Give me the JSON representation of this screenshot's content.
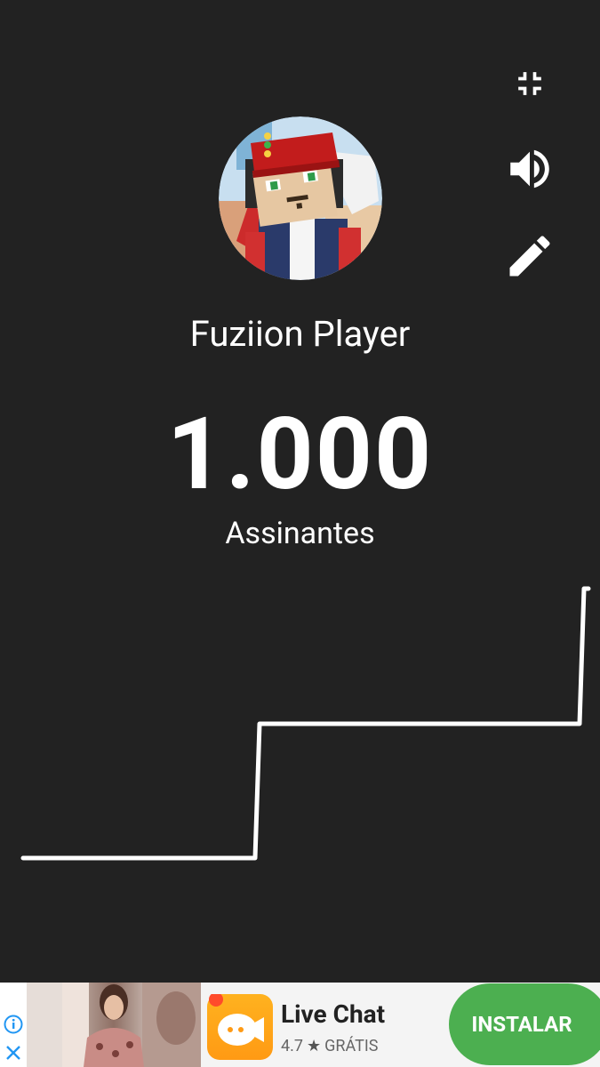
{
  "controls": {
    "collapse_icon": "fullscreen-exit-icon",
    "volume_icon": "volume-up-icon",
    "edit_icon": "pencil-icon"
  },
  "channel": {
    "name": "Fuziion Player",
    "avatar_icon": "channel-avatar"
  },
  "counter": {
    "count": "1.000",
    "label": "Assinantes"
  },
  "chart_data": {
    "type": "line",
    "shape": "step",
    "steps": 3,
    "color": "#ffffff"
  },
  "ad": {
    "app_name": "Live Chat",
    "rating": "4.7",
    "price": "GRÁTIS",
    "cta": "INSTALAR",
    "cta_color": "#4caf50",
    "info_icon": "info-icon",
    "close_icon": "close-icon"
  },
  "colors": {
    "background": "#222222",
    "text": "#ffffff"
  }
}
